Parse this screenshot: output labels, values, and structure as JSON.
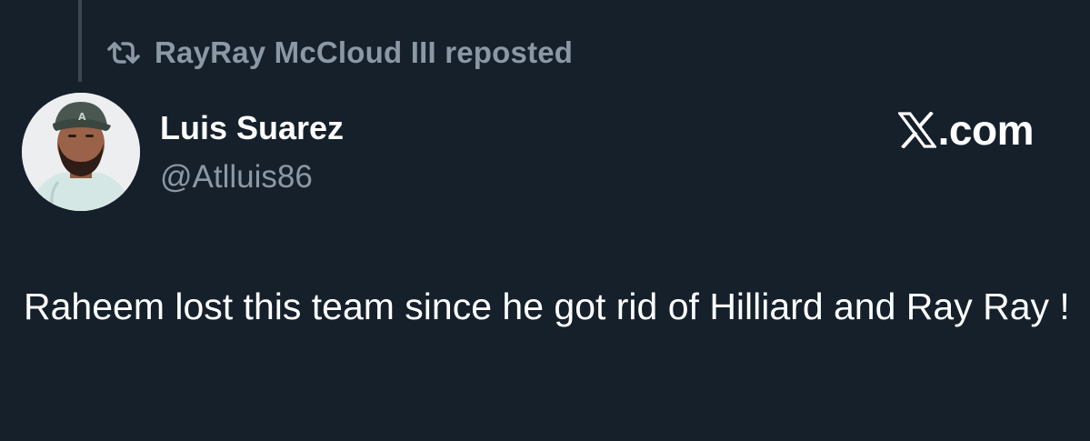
{
  "repost": {
    "icon": "repost-icon",
    "text": "RayRay McCloud III reposted"
  },
  "author": {
    "avatar_icon": "avatar",
    "display_name": "Luis Suarez",
    "handle": "@Atlluis86"
  },
  "brand": {
    "logo_icon": "x-logo-icon",
    "domain": ".com"
  },
  "tweet": {
    "text": "Raheem lost this team since he got rid of Hilliard and Ray Ray !"
  },
  "colors": {
    "background": "#15202b",
    "primary_text": "#ffffff",
    "secondary_text": "#8b98a5",
    "thread_line": "#3a4652"
  }
}
